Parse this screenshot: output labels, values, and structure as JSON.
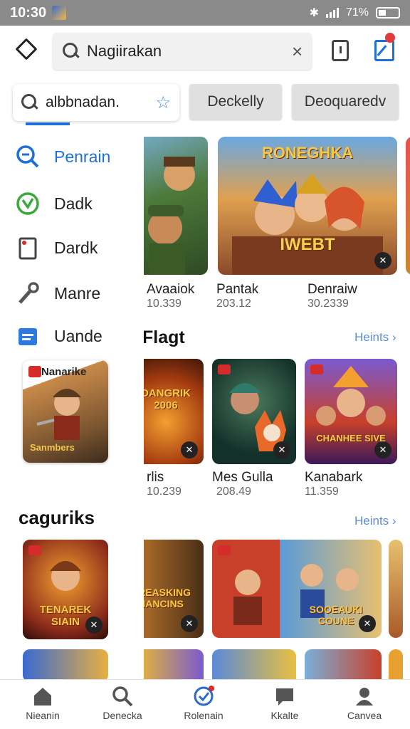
{
  "status_bar": {
    "time": "10:30",
    "battery": "71%"
  },
  "top_bar": {
    "search_value": "Nagiirakan"
  },
  "filter": {
    "search_text": "albbnadan.",
    "chips": [
      "Deckelly",
      "Deoquaredv"
    ]
  },
  "drawer": {
    "items": [
      {
        "label": "Penrain",
        "icon": "search-list-icon",
        "active": true
      },
      {
        "label": "Dadk",
        "icon": "check-circle-icon"
      },
      {
        "label": "Dardk",
        "icon": "tablet-icon"
      },
      {
        "label": "Manre",
        "icon": "wrench-icon"
      },
      {
        "label": "Uande",
        "icon": "folder-icon"
      }
    ],
    "feature_card": {
      "title": "Nanarike",
      "logo": "Sanmbers"
    },
    "category_title": "caguriks"
  },
  "section1": {
    "cards": [
      {
        "title": "Avaaiok",
        "sub": "10.339"
      },
      {
        "title": "Pantak",
        "sub": "203.12",
        "banner": "RONEGHKA",
        "badge": "IWEBT"
      },
      {
        "title": "Denraiw",
        "sub": "30.2339"
      }
    ]
  },
  "section2": {
    "title": "Flagt",
    "more": "Heints",
    "cards": [
      {
        "title": "rlis",
        "sub": "10.239",
        "banner": "DANGRIK 2006"
      },
      {
        "title": "Mes Gulla",
        "sub": "208.49"
      },
      {
        "title": "Kanabark",
        "sub": "11.359",
        "banner": "CHANHEE SIVE"
      }
    ]
  },
  "section3": {
    "more": "Heints",
    "cards": [
      {
        "banner": "TENAREK SIAIN"
      },
      {
        "banner": "CREASKING NANCINS"
      },
      {
        "banner": "SOOEAUKI COUNE"
      }
    ]
  },
  "bottom_nav": {
    "items": [
      "Nieanin",
      "Denecka",
      "Rolenain",
      "Kkalte",
      "Canvea"
    ]
  }
}
